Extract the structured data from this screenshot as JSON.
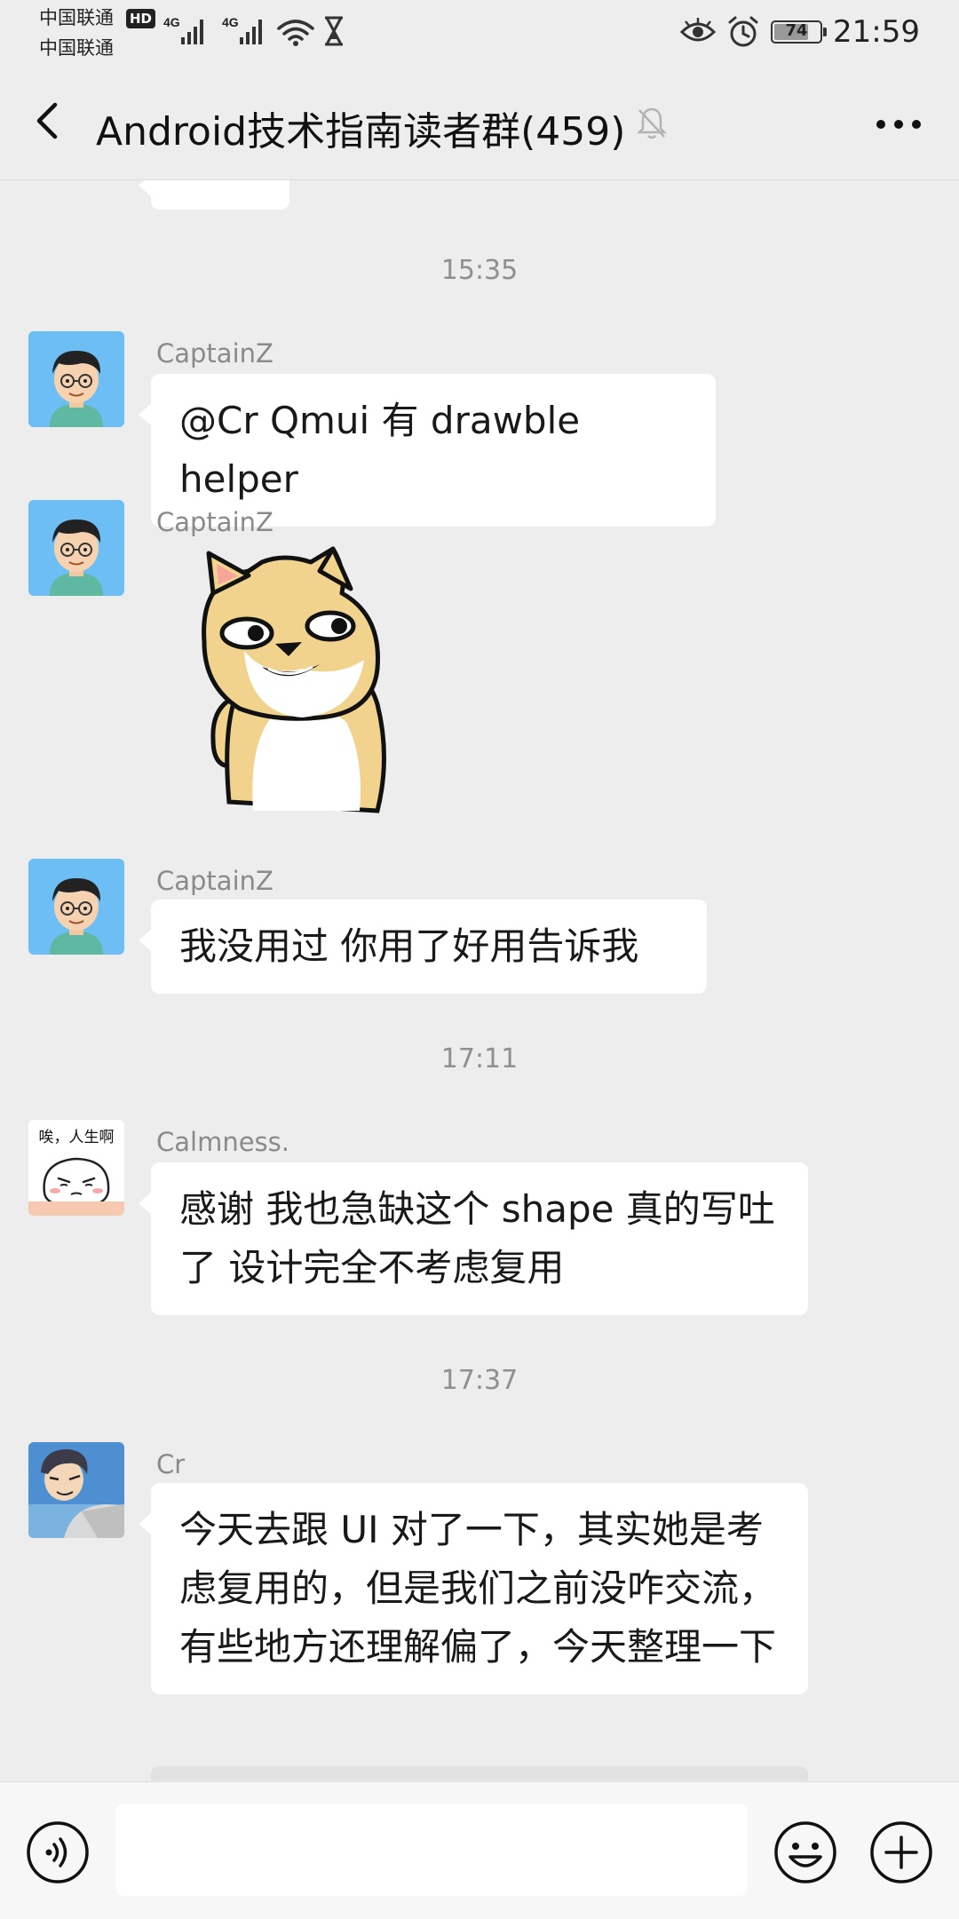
{
  "status_bar": {
    "carrier_1": "中国联通",
    "carrier_2": "中国联通",
    "hd_badge": "HD",
    "network_1": "4G",
    "network_2": "4G",
    "battery_level": "74",
    "time": "21:59",
    "icons": [
      "signal-icon",
      "wifi-icon",
      "hourglass-icon",
      "eye-icon",
      "alarm-icon",
      "battery-icon"
    ]
  },
  "header": {
    "title": "Android技术指南读者群(459)",
    "icons": [
      "back-arrow-icon",
      "muted-bell-icon",
      "more-dots-icon"
    ]
  },
  "messages": [
    {
      "type": "time",
      "text": "15:35"
    },
    {
      "type": "text",
      "sender": "CaptainZ",
      "text": "@Cr Qmui 有 drawble helper"
    },
    {
      "type": "sticker",
      "sender": "CaptainZ",
      "sticker": "shiba-dog-sticker"
    },
    {
      "type": "text",
      "sender": "CaptainZ",
      "text": "我没用过 你用了好用告诉我"
    },
    {
      "type": "time",
      "text": "17:11"
    },
    {
      "type": "text",
      "sender": "Calmness.",
      "avatar_caption": "唉，人生啊",
      "text": "感谢  我也急缺这个  shape 真的写吐了  设计完全不考虑复用"
    },
    {
      "type": "time",
      "text": "17:37"
    },
    {
      "type": "text",
      "sender": "Cr",
      "text": "今天去跟 UI 对了一下，其实她是考虑复用的，但是我们之前没咋交流，有些地方还理解偏了，今天整理一下"
    }
  ],
  "input_bar": {
    "icons": [
      "voice-icon",
      "emoji-icon",
      "plus-icon"
    ]
  },
  "colors": {
    "background": "#ededed",
    "bubble": "#ffffff",
    "text": "#191919",
    "meta": "#8a8a8a"
  }
}
